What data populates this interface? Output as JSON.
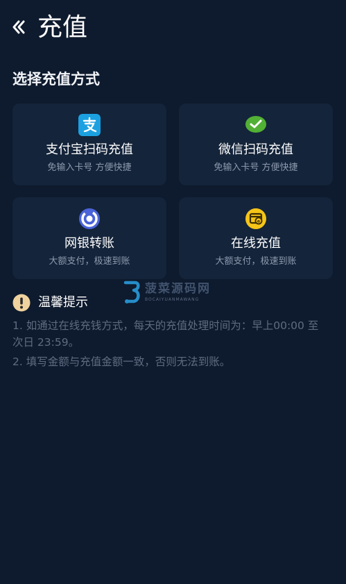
{
  "header": {
    "title": "充值",
    "back_icon": "chevron-double-left-icon"
  },
  "section_title": "选择充值方式",
  "methods": [
    {
      "id": "alipay",
      "title": "支付宝扫码充值",
      "subtitle": "免输入卡号 方便快捷",
      "icon": "alipay-icon",
      "color": "#1ba1e2"
    },
    {
      "id": "wechat",
      "title": "微信扫码充值",
      "subtitle": "免输入卡号 方便快捷",
      "icon": "wechat-icon",
      "color": "#52b035"
    },
    {
      "id": "bank",
      "title": "网银转账",
      "subtitle": "大额支付，极速到账",
      "icon": "bank-icon",
      "color": "#4a63d8"
    },
    {
      "id": "online",
      "title": "在线充值",
      "subtitle": "大额支付，极速到账",
      "icon": "online-pay-icon",
      "color": "#f5c518"
    }
  ],
  "tips": {
    "title": "温馨提示",
    "icon": "warning-icon",
    "items": [
      "1. 如通过在线充钱方式，每天的充值处理时间为：早上00:00 至次日 23:59。",
      "2. 填写金额与充值金额一致，否则无法到账。"
    ]
  },
  "watermark": {
    "text": "菠菜源码网",
    "subtext": "BOCAIYUANMAWANG"
  },
  "colors": {
    "background": "#0e1a2d",
    "card": "#14243a",
    "subtext": "#8e9aaf",
    "tip_text": "#5f6b80"
  }
}
